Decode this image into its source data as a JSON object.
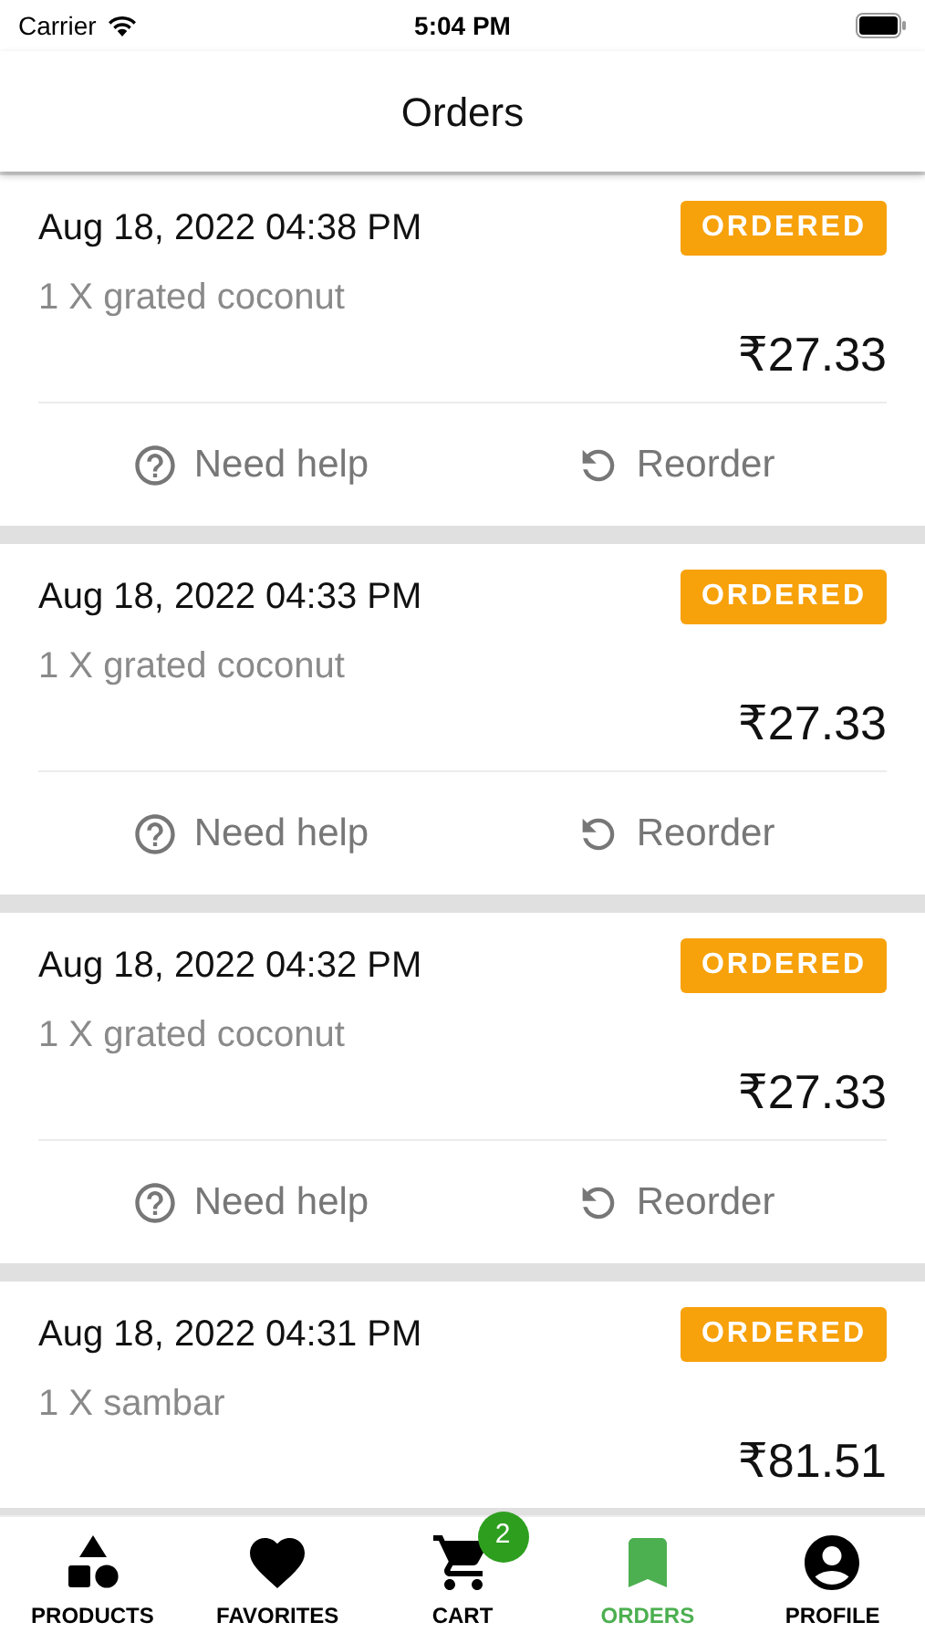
{
  "status_bar": {
    "carrier": "Carrier",
    "time": "5:04 PM"
  },
  "header": {
    "title": "Orders"
  },
  "orders": [
    {
      "date": "Aug 18, 2022 04:38 PM",
      "status": "ORDERED",
      "item": "1 X grated coconut",
      "price": "₹27.33",
      "actions": [
        {
          "kind": "help",
          "label": "Need help"
        },
        {
          "kind": "reorder",
          "label": "Reorder"
        }
      ]
    },
    {
      "date": "Aug 18, 2022 04:33 PM",
      "status": "ORDERED",
      "item": "1 X grated coconut",
      "price": "₹27.33",
      "actions": [
        {
          "kind": "help",
          "label": "Need help"
        },
        {
          "kind": "reorder",
          "label": "Reorder"
        }
      ]
    },
    {
      "date": "Aug 18, 2022 04:32 PM",
      "status": "ORDERED",
      "item": "1 X grated coconut",
      "price": "₹27.33",
      "actions": [
        {
          "kind": "help",
          "label": "Need help"
        },
        {
          "kind": "reorder",
          "label": "Reorder"
        }
      ]
    },
    {
      "date": "Aug 18, 2022 04:31 PM",
      "status": "ORDERED",
      "item": "1 X sambar",
      "price": "₹81.51"
    }
  ],
  "tab_bar": [
    {
      "kind": "products",
      "label": "PRODUCTS",
      "selected": false
    },
    {
      "kind": "favorites",
      "label": "FAVORITES",
      "selected": false
    },
    {
      "kind": "cart",
      "label": "CART",
      "selected": false,
      "badge": "2"
    },
    {
      "kind": "orders",
      "label": "ORDERS",
      "selected": true
    },
    {
      "kind": "profile",
      "label": "PROFILE",
      "selected": false
    }
  ]
}
